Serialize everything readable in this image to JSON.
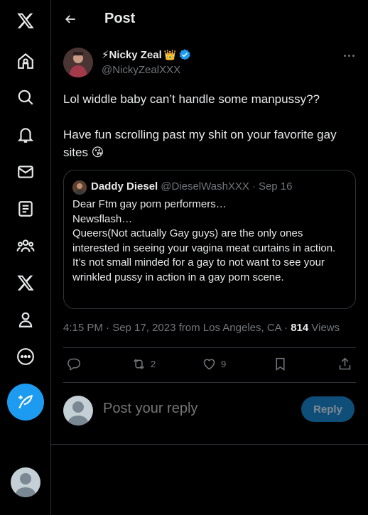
{
  "sidebar": {
    "items": [
      {
        "icon": "x-logo-icon"
      },
      {
        "icon": "home-icon"
      },
      {
        "icon": "search-icon"
      },
      {
        "icon": "notifications-icon"
      },
      {
        "icon": "messages-icon"
      },
      {
        "icon": "lists-icon"
      },
      {
        "icon": "communities-icon"
      },
      {
        "icon": "premium-x-icon"
      },
      {
        "icon": "profile-icon"
      },
      {
        "icon": "more-icon"
      }
    ],
    "compose_icon": "compose-feather-icon"
  },
  "header": {
    "title": "Post"
  },
  "post": {
    "author_name": "⚡Nicky Zeal",
    "author_emoji": "👑",
    "handle": "@NickyZealXXX",
    "text": "Lol widdle baby can’t handle some manpussy??\n\nHave fun scrolling past my shit on your favorite gay sites 😘",
    "quote": {
      "name": "Daddy Diesel",
      "handle": "@DieselWashXXX",
      "separator": "·",
      "date": "Sep 16",
      "lines": [
        "Dear Ftm gay porn performers…",
        "Newsflash…",
        "Queers(Not actually Gay guys) are the only ones interested in seeing your vagina meat curtains in action.",
        "It’s not small minded for a gay to not want to see your wrinkled pussy in action in a gay porn scene."
      ]
    },
    "timestamp": "4:15 PM · Sep 17, 2023 from Los Angeles, CA · ",
    "views_count": "814",
    "views_label": " Views",
    "actions": {
      "reply_count": "",
      "repost_count": "2",
      "like_count": "9"
    }
  },
  "reply": {
    "placeholder": "Post your reply",
    "button": "Reply"
  },
  "colors": {
    "accent": "#1d9bf0",
    "verified": "#1d9bf0",
    "background": "#000000",
    "border": "#2f3336",
    "secondary_text": "#71767b"
  }
}
